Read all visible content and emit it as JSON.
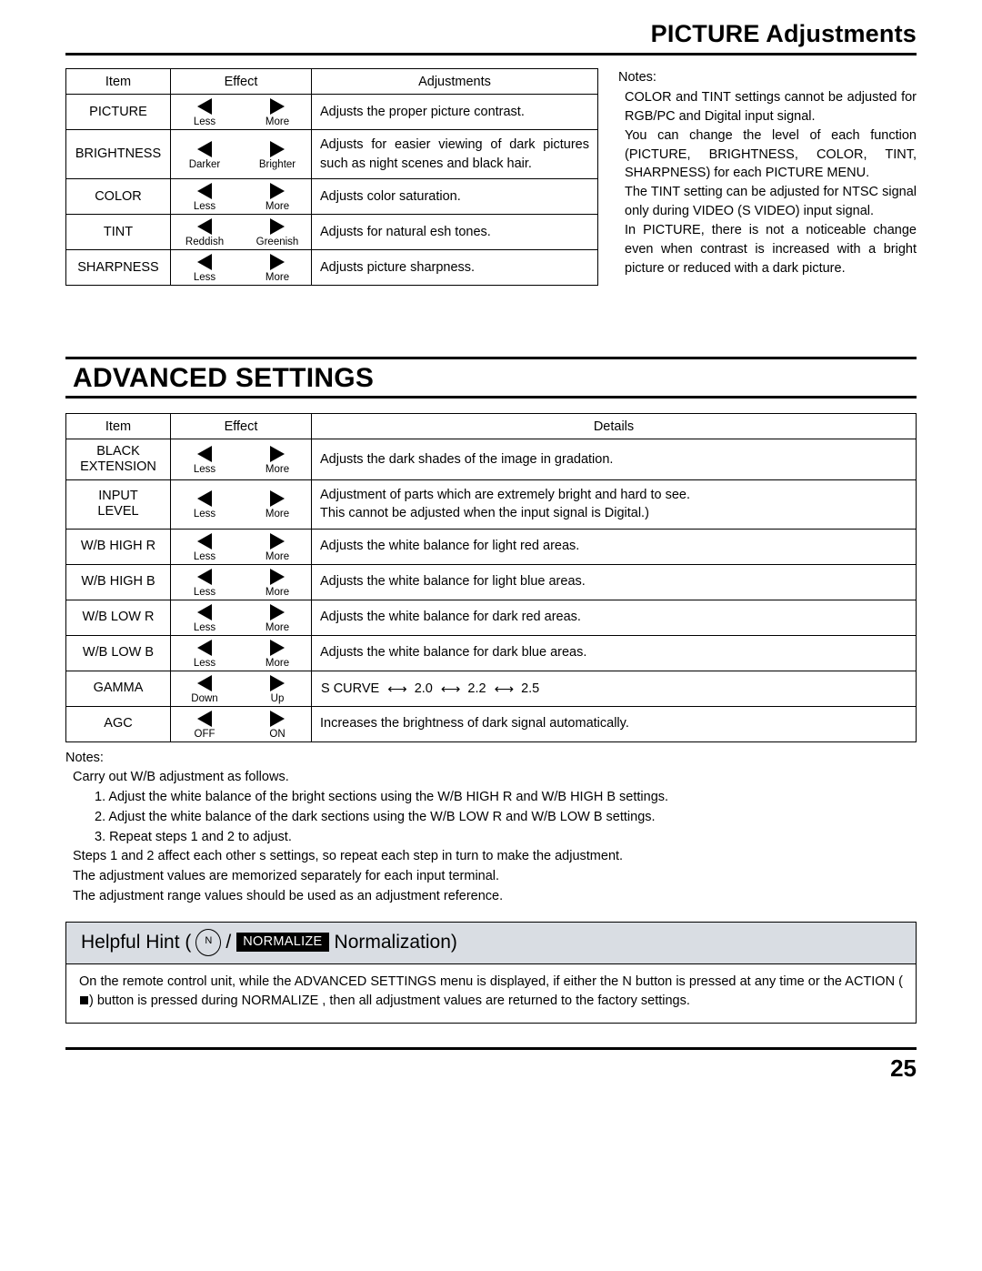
{
  "header": {
    "title": "PICTURE Adjustments"
  },
  "picture_table": {
    "columns": [
      "Item",
      "Effect",
      "Adjustments"
    ],
    "rows": [
      {
        "item": "PICTURE",
        "left_label": "Less",
        "right_label": "More",
        "desc": "Adjusts the proper picture contrast."
      },
      {
        "item": "BRIGHTNESS",
        "left_label": "Darker",
        "right_label": "Brighter",
        "desc": "Adjusts for easier viewing of dark pictures such as night scenes and black hair."
      },
      {
        "item": "COLOR",
        "left_label": "Less",
        "right_label": "More",
        "desc": "Adjusts color saturation."
      },
      {
        "item": "TINT",
        "left_label": "Reddish",
        "right_label": "Greenish",
        "desc": "Adjusts for natural  esh tones."
      },
      {
        "item": "SHARPNESS",
        "left_label": "Less",
        "right_label": "More",
        "desc": "Adjusts picture sharpness."
      }
    ]
  },
  "picture_notes": {
    "title": "Notes:",
    "paragraphs": [
      "COLOR and TINT settings cannot be adjusted for RGB/PC and Digital input signal.",
      "You can change the level of each function (PICTURE, BRIGHTNESS, COLOR, TINT, SHARPNESS) for each PICTURE MENU.",
      "The TINT setting can be adjusted for NTSC signal only during VIDEO (S VIDEO) input signal.",
      "In PICTURE, there is not a noticeable change even when contrast is increased with a bright picture or reduced with a dark picture."
    ]
  },
  "advanced": {
    "title": "ADVANCED SETTINGS",
    "columns": [
      "Item",
      "Effect",
      "Details"
    ],
    "rows": [
      {
        "item": "BLACK\nEXTENSION",
        "left_label": "Less",
        "right_label": "More",
        "desc": "Adjusts the dark shades of the image in gradation."
      },
      {
        "item": "INPUT\nLEVEL",
        "left_label": "Less",
        "right_label": "More",
        "desc": "Adjustment of parts which are extremely bright and hard to see.\nThis cannot be adjusted when the input signal is Digital.)"
      },
      {
        "item": "W/B HIGH R",
        "left_label": "Less",
        "right_label": "More",
        "desc": "Adjusts the white balance for light red areas."
      },
      {
        "item": "W/B HIGH B",
        "left_label": "Less",
        "right_label": "More",
        "desc": "Adjusts the white balance for light blue areas."
      },
      {
        "item": "W/B LOW R",
        "left_label": "Less",
        "right_label": "More",
        "desc": "Adjusts the white balance for dark red areas."
      },
      {
        "item": "W/B LOW B",
        "left_label": "Less",
        "right_label": "More",
        "desc": "Adjusts the white balance for dark blue areas."
      },
      {
        "item": "GAMMA",
        "left_label": "Down",
        "right_label": "Up",
        "desc": "S CURVE",
        "gamma_values": [
          "2.0",
          "2.2",
          "2.5"
        ]
      },
      {
        "item": "AGC",
        "left_label": "OFF",
        "right_label": "ON",
        "desc": "Increases the brightness of dark signal automatically."
      }
    ]
  },
  "advanced_notes": {
    "title": "Notes:",
    "lines": [
      "Carry out  W/B  adjustment as follows.",
      "1. Adjust the white balance of the bright sections using the  W/B HIGH R  and  W/B HIGH B  settings.",
      "2. Adjust the white balance of the dark sections using the  W/B LOW R  and  W/B LOW B  settings.",
      "3. Repeat steps 1 and 2 to adjust.",
      "Steps 1 and 2 affect each other s settings, so repeat each step in turn to make the adjustment.",
      "The adjustment values are memorized separately for each input terminal.",
      "The adjustment range values should be used as an adjustment reference."
    ]
  },
  "hint": {
    "prefix": "Helpful Hint  (",
    "n_button": "N",
    "slash": "/",
    "chip": "NORMALIZE",
    "suffix": "Normalization)",
    "body_part1": "On the remote control unit, while the  ADVANCED SETTINGS  menu is displayed, if either the N button is pressed at any time or the ACTION (",
    "body_part2": ") button is pressed during  NORMALIZE , then all adjustment values are returned to the factory settings."
  },
  "footer": {
    "page_number": "25"
  }
}
